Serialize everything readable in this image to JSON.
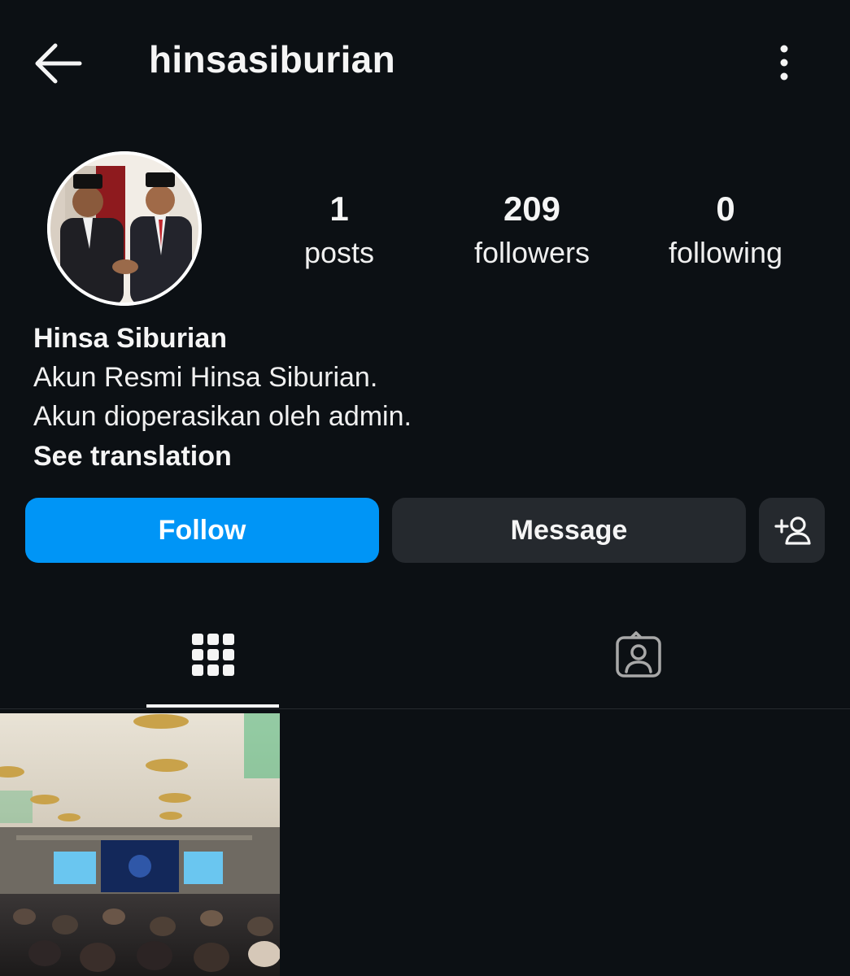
{
  "header": {
    "username": "hinsasiburian",
    "back_icon": "arrow-left-icon",
    "more_icon": "more-vertical-icon"
  },
  "profile": {
    "avatar_icon": "profile-photo",
    "stats": [
      {
        "value": "1",
        "label": "posts"
      },
      {
        "value": "209",
        "label": "followers"
      },
      {
        "value": "0",
        "label": "following"
      }
    ],
    "name": "Hinsa Siburian",
    "bio_lines": [
      "Akun Resmi Hinsa Siburian.",
      "Akun dioperasikan oleh admin."
    ],
    "translate_label": "See translation"
  },
  "actions": {
    "follow_label": "Follow",
    "message_label": "Message",
    "add_user_icon": "add-user-icon"
  },
  "tabs": {
    "grid_icon": "grid-icon",
    "tagged_icon": "tagged-user-icon",
    "active": "grid"
  },
  "posts": {
    "count_shown": 1
  },
  "colors": {
    "background": "#0c1014",
    "follow_button": "#0095f6",
    "secondary_button": "#25292e",
    "text": "#f5f5f5"
  }
}
